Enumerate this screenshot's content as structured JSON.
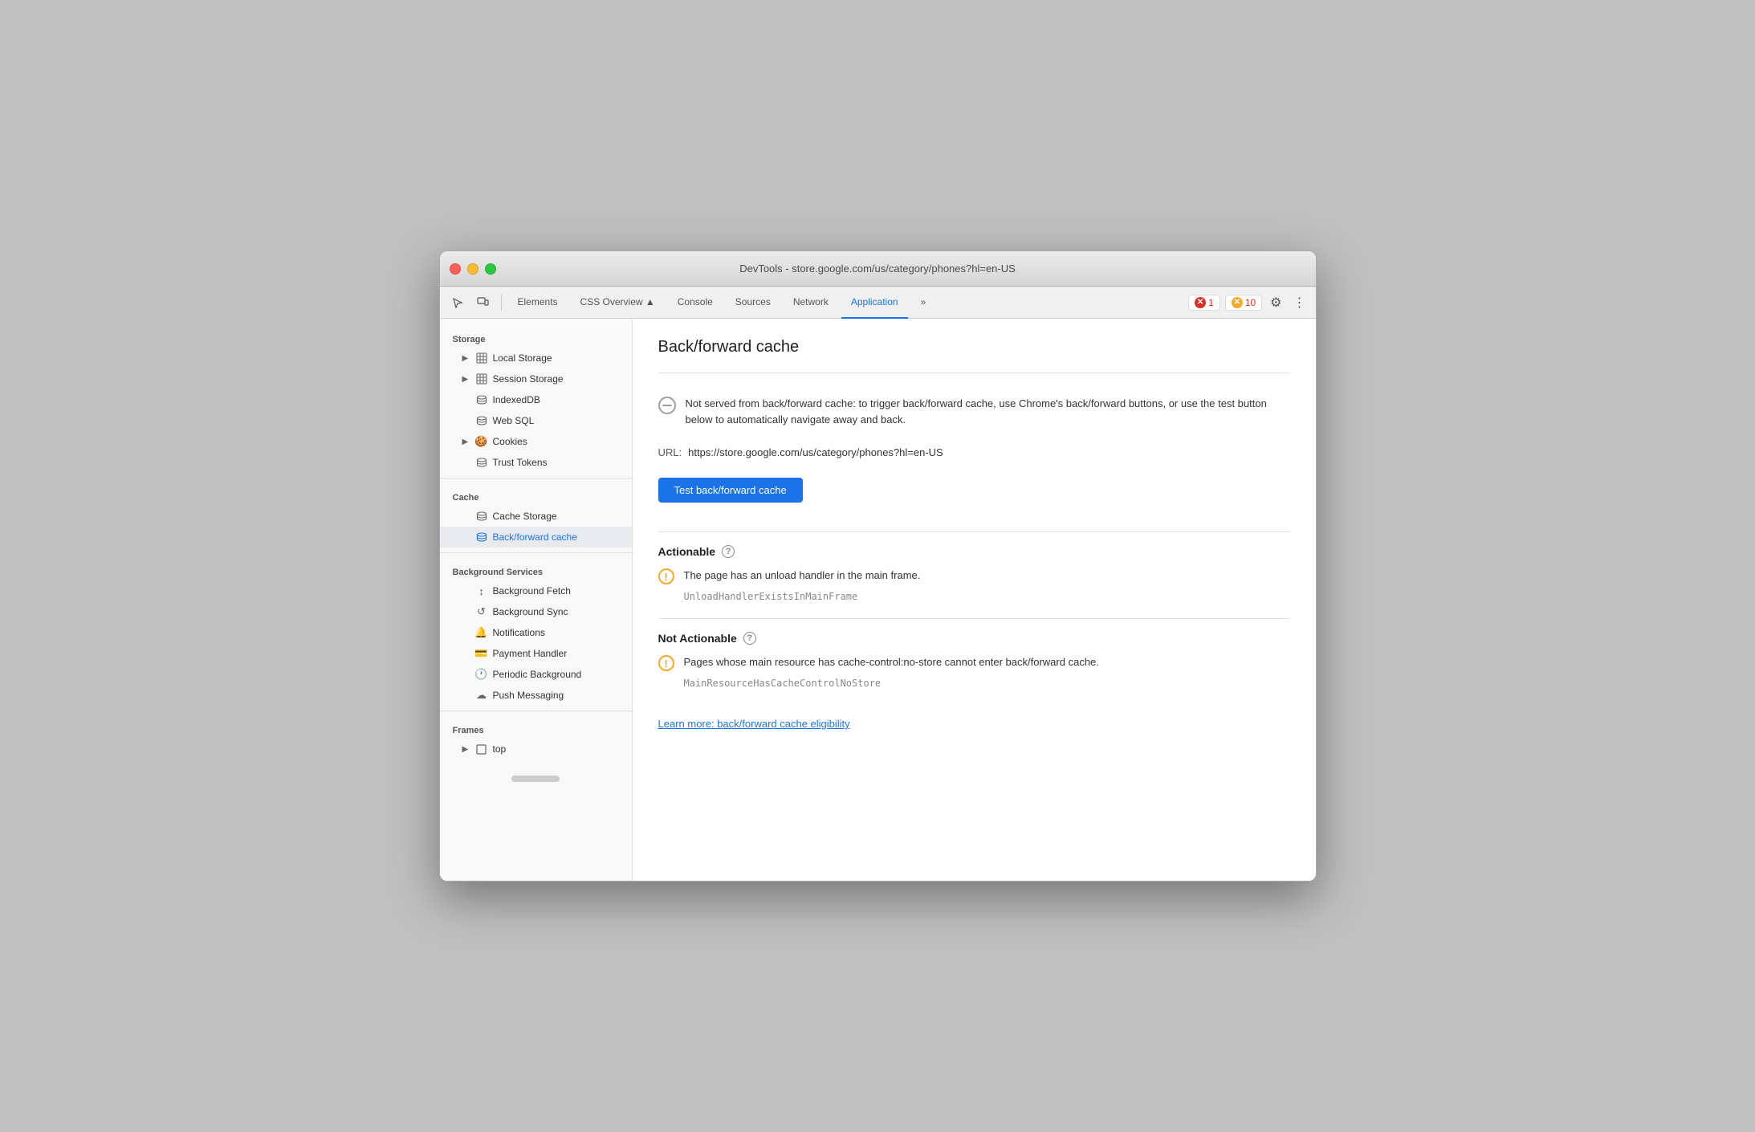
{
  "window": {
    "title": "DevTools - store.google.com/us/category/phones?hl=en-US"
  },
  "toolbar": {
    "tabs": [
      {
        "id": "elements",
        "label": "Elements",
        "active": false
      },
      {
        "id": "css-overview",
        "label": "CSS Overview ▲",
        "active": false
      },
      {
        "id": "console",
        "label": "Console",
        "active": false
      },
      {
        "id": "sources",
        "label": "Sources",
        "active": false
      },
      {
        "id": "network",
        "label": "Network",
        "active": false
      },
      {
        "id": "application",
        "label": "Application",
        "active": true
      }
    ],
    "more_label": "»",
    "error_count": "1",
    "warning_count": "10",
    "gear_icon": "⚙",
    "more_icon": "⋮"
  },
  "sidebar": {
    "storage_label": "Storage",
    "items": [
      {
        "id": "local-storage",
        "label": "Local Storage",
        "indent": 1,
        "icon": "grid",
        "arrow": "▶"
      },
      {
        "id": "session-storage",
        "label": "Session Storage",
        "indent": 1,
        "icon": "grid",
        "arrow": "▶"
      },
      {
        "id": "indexeddb",
        "label": "IndexedDB",
        "indent": 1,
        "icon": "db"
      },
      {
        "id": "web-sql",
        "label": "Web SQL",
        "indent": 1,
        "icon": "db"
      },
      {
        "id": "cookies",
        "label": "Cookies",
        "indent": 1,
        "icon": "cookie",
        "arrow": "▶"
      },
      {
        "id": "trust-tokens",
        "label": "Trust Tokens",
        "indent": 1,
        "icon": "db"
      }
    ],
    "cache_label": "Cache",
    "cache_items": [
      {
        "id": "cache-storage",
        "label": "Cache Storage",
        "indent": 1,
        "icon": "db"
      },
      {
        "id": "back-forward-cache",
        "label": "Back/forward cache",
        "indent": 1,
        "icon": "db",
        "active": true
      }
    ],
    "bg_services_label": "Background Services",
    "bg_items": [
      {
        "id": "background-fetch",
        "label": "Background Fetch",
        "indent": 1,
        "icon": "arrows"
      },
      {
        "id": "background-sync",
        "label": "Background Sync",
        "indent": 1,
        "icon": "sync"
      },
      {
        "id": "notifications",
        "label": "Notifications",
        "indent": 1,
        "icon": "bell"
      },
      {
        "id": "payment-handler",
        "label": "Payment Handler",
        "indent": 1,
        "icon": "card"
      },
      {
        "id": "periodic-background",
        "label": "Periodic Background",
        "indent": 1,
        "icon": "clock"
      },
      {
        "id": "push-messaging",
        "label": "Push Messaging",
        "indent": 1,
        "icon": "cloud"
      }
    ],
    "frames_label": "Frames",
    "frames_items": [
      {
        "id": "top-frame",
        "label": "top",
        "indent": 1,
        "icon": "frame",
        "arrow": "▶"
      }
    ]
  },
  "content": {
    "page_title": "Back/forward cache",
    "info_message": "Not served from back/forward cache: to trigger back/forward cache, use Chrome's back/forward buttons, or use the test button below to automatically navigate away and back.",
    "url_label": "URL:",
    "url_value": "https://store.google.com/us/category/phones?hl=en-US",
    "test_button_label": "Test back/forward cache",
    "actionable_title": "Actionable",
    "actionable_warning": "The page has an unload handler in the main frame.",
    "actionable_code": "UnloadHandlerExistsInMainFrame",
    "not_actionable_title": "Not Actionable",
    "not_actionable_warning": "Pages whose main resource has cache-control:no-store cannot enter back/forward cache.",
    "not_actionable_code": "MainResourceHasCacheControlNoStore",
    "learn_more_label": "Learn more: back/forward cache eligibility"
  }
}
